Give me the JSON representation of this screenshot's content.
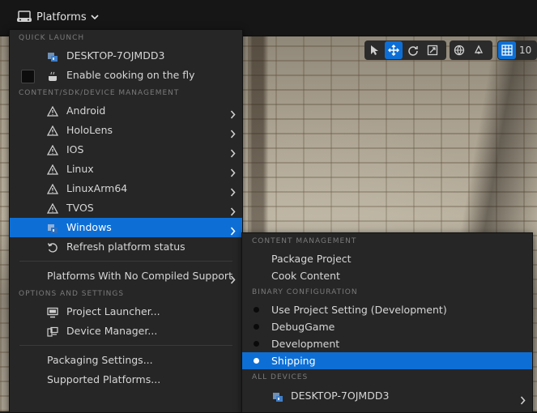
{
  "topbar": {
    "platforms_label": "Platforms"
  },
  "viewport_toolbar": {
    "grid_value": "10"
  },
  "menu": {
    "quick_launch_header": "QUICK LAUNCH",
    "device_label": "DESKTOP-7OJMDD3",
    "cooking_label": "Enable cooking on the fly",
    "sdk_header": "CONTENT/SDK/DEVICE MANAGEMENT",
    "platforms": [
      {
        "label": "Android"
      },
      {
        "label": "HoloLens"
      },
      {
        "label": "IOS"
      },
      {
        "label": "Linux"
      },
      {
        "label": "LinuxArm64"
      },
      {
        "label": "TVOS"
      }
    ],
    "windows_label": "Windows",
    "refresh_label": "Refresh platform status",
    "no_compiled_label": "Platforms With No Compiled Support",
    "options_header": "OPTIONS AND SETTINGS",
    "launcher_label": "Project Launcher...",
    "device_manager_label": "Device Manager...",
    "packaging_label": "Packaging Settings...",
    "supported_label": "Supported Platforms..."
  },
  "submenu": {
    "content_header": "CONTENT MANAGEMENT",
    "package_label": "Package Project",
    "cook_label": "Cook Content",
    "binary_header": "BINARY CONFIGURATION",
    "configs": [
      {
        "label": "Use Project Setting (Development)"
      },
      {
        "label": "DebugGame"
      },
      {
        "label": "Development"
      }
    ],
    "shipping_label": "Shipping",
    "all_devices_header": "ALL DEVICES",
    "device_label": "DESKTOP-7OJMDD3"
  },
  "colors": {
    "highlight": "#0d6fd6",
    "menu_bg": "#262626",
    "header_text": "#7a7a7a"
  }
}
